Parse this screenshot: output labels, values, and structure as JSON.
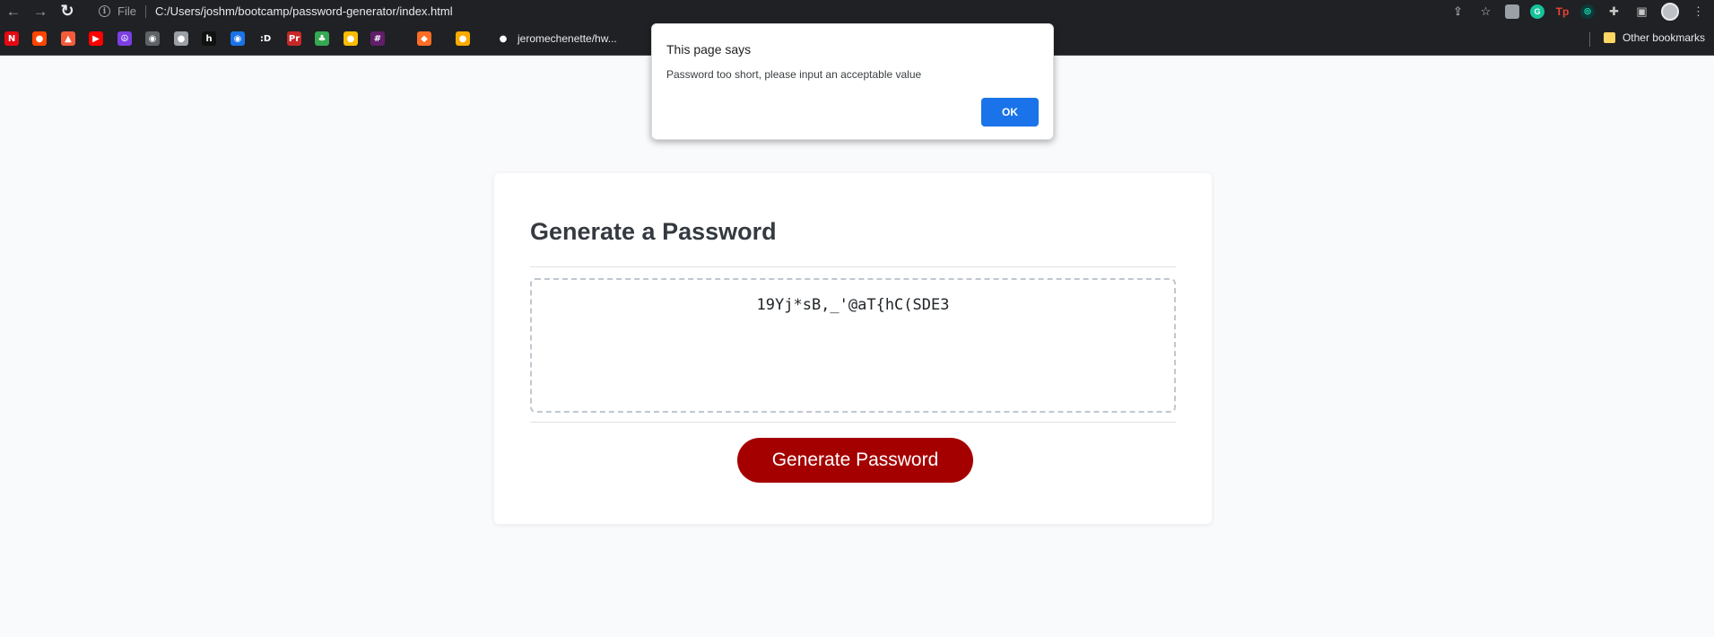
{
  "browser": {
    "back_icon": "arrow-left-icon",
    "forward_icon": "arrow-right-icon",
    "reload_icon": "reload-icon",
    "scheme_label": "File",
    "url": "C:/Users/joshm/bootcamp/password-generator/index.html"
  },
  "bookmarks": {
    "items": [
      {
        "icon": "netflix-icon",
        "glyph": "N",
        "color": "#e50914"
      },
      {
        "icon": "reddit-icon",
        "glyph": "●",
        "color": "#ff4500"
      },
      {
        "icon": "bookmark-red-icon",
        "glyph": "▲",
        "color": "#f25c3b"
      },
      {
        "icon": "youtube-icon",
        "glyph": "▶",
        "color": "#ff0000"
      },
      {
        "icon": "peace-icon",
        "glyph": "☮",
        "color": "#7b3fe4"
      },
      {
        "icon": "globe-icon",
        "glyph": "◉",
        "color": "#5f6368"
      },
      {
        "icon": "apple-icon",
        "glyph": "●",
        "color": "#9aa0a6"
      },
      {
        "icon": "h-icon",
        "glyph": "h",
        "color": "#111111"
      },
      {
        "icon": "chrome-icon",
        "glyph": "◉",
        "color": "#1a73e8"
      },
      {
        "icon": "d-icon",
        "glyph": ":D",
        "color": "#202124"
      },
      {
        "icon": "pr-icon",
        "glyph": "Pr",
        "color": "#c62828"
      },
      {
        "icon": "tree-icon",
        "glyph": "♣",
        "color": "#34a853"
      },
      {
        "icon": "coin-icon",
        "glyph": "●",
        "color": "#fbbc04"
      },
      {
        "icon": "slack-icon",
        "glyph": "#",
        "color": "#611f69"
      },
      {
        "icon": "gitlab-icon",
        "glyph": "◆",
        "color": "#fc6d26"
      },
      {
        "icon": "yellow-round-icon",
        "glyph": "●",
        "color": "#f9ab00"
      },
      {
        "icon": "github-icon",
        "glyph": "●",
        "color": "#202124"
      }
    ],
    "text_item": "jeromechenette/hw...",
    "other": "Other bookmarks"
  },
  "dialog": {
    "title": "This page says",
    "message": "Password too short, please input an acceptable value",
    "ok_label": "OK"
  },
  "card": {
    "title": "Generate a Password",
    "password": "19Yj*sB,_'@aT{hC(SDE3",
    "button_label": "Generate Password"
  },
  "colors": {
    "button": "#a50000",
    "ok_button": "#1a73e8",
    "title": "#343a40"
  }
}
